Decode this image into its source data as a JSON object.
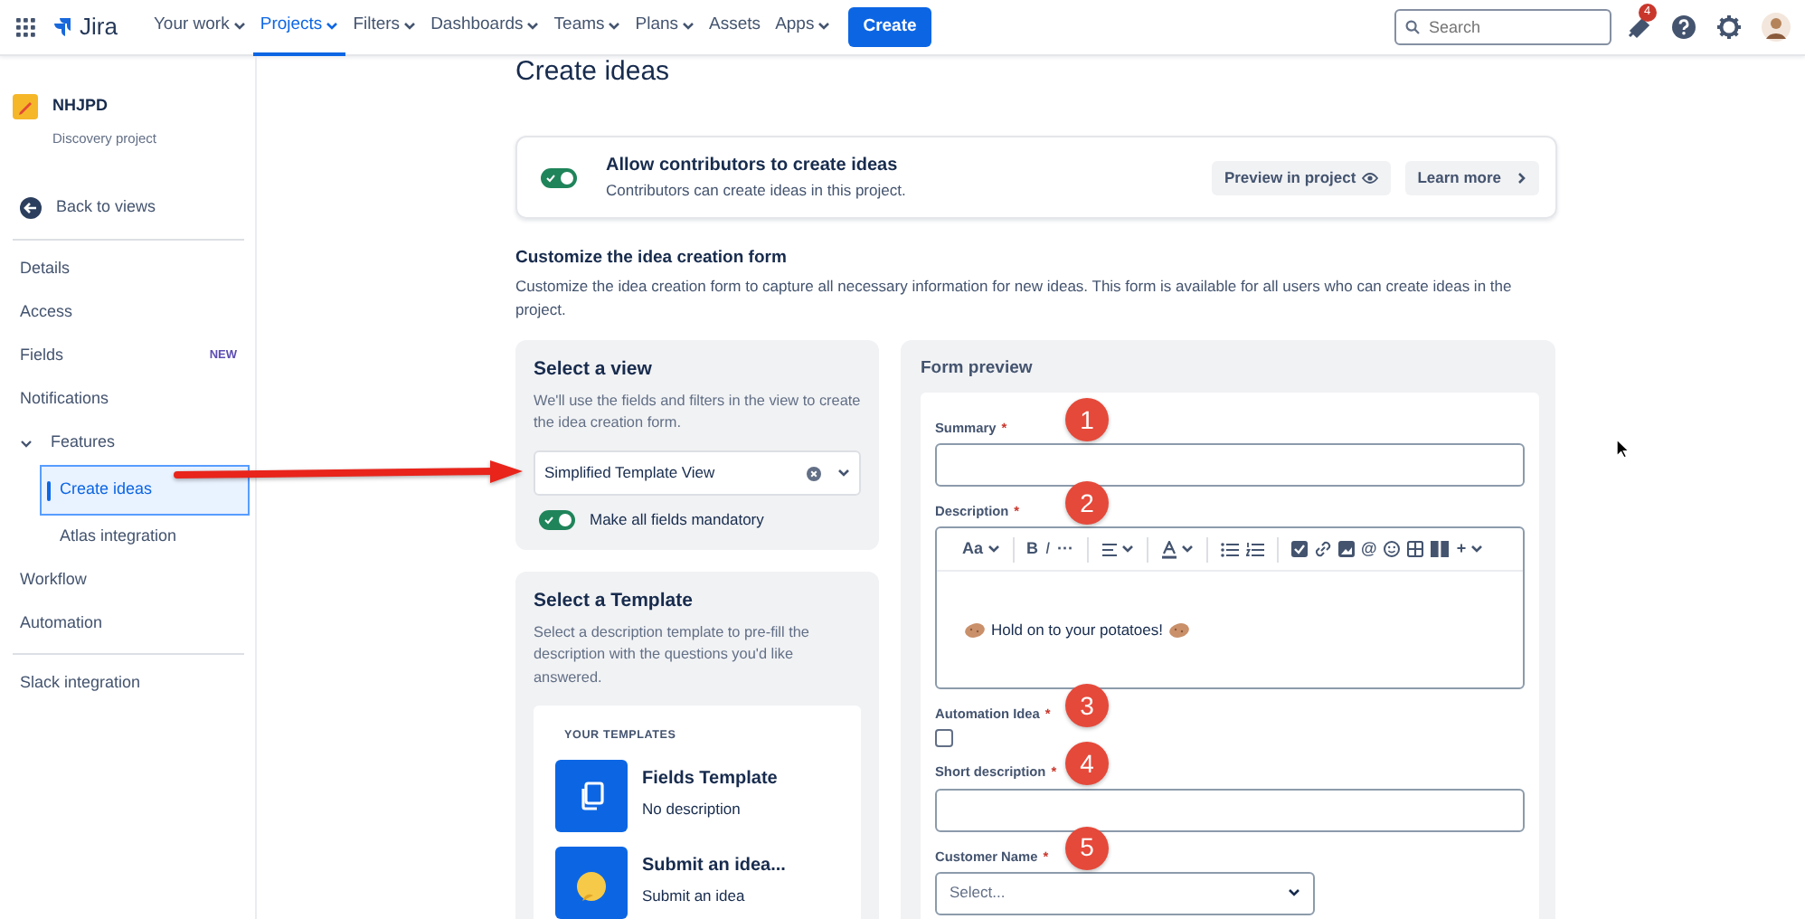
{
  "topnav": {
    "logo": "Jira",
    "items": [
      {
        "label": "Your work",
        "dropdown": true,
        "selected": false
      },
      {
        "label": "Projects",
        "dropdown": true,
        "selected": true
      },
      {
        "label": "Filters",
        "dropdown": true,
        "selected": false
      },
      {
        "label": "Dashboards",
        "dropdown": true,
        "selected": false
      },
      {
        "label": "Teams",
        "dropdown": true,
        "selected": false
      },
      {
        "label": "Plans",
        "dropdown": true,
        "selected": false
      },
      {
        "label": "Assets",
        "dropdown": false,
        "selected": false
      },
      {
        "label": "Apps",
        "dropdown": true,
        "selected": false
      }
    ],
    "create": "Create",
    "search": {
      "placeholder": "Search"
    },
    "notification_count": "4"
  },
  "sidebar": {
    "project": {
      "name": "NHJPD",
      "type": "Discovery project"
    },
    "back": "Back to views",
    "items": [
      {
        "label": "Details",
        "selected": false
      },
      {
        "label": "Access",
        "selected": false
      },
      {
        "label": "Fields",
        "selected": false,
        "badge": "NEW"
      },
      {
        "label": "Notifications",
        "selected": false
      },
      {
        "label": "Features",
        "selected": false,
        "expanded": true,
        "children": [
          {
            "label": "Create ideas",
            "selected": true
          },
          {
            "label": "Atlas integration",
            "selected": false
          }
        ]
      },
      {
        "label": "Workflow",
        "selected": false
      },
      {
        "label": "Automation",
        "selected": false
      }
    ],
    "footer_items": [
      {
        "label": "Slack integration",
        "selected": false
      }
    ]
  },
  "page": {
    "title": "Create ideas",
    "allow": {
      "on": true,
      "title": "Allow contributors to create ideas",
      "subtitle": "Contributors can create ideas in this project.",
      "buttons": [
        {
          "label": "Preview in project",
          "kind": "preview"
        },
        {
          "label": "Learn more",
          "kind": "more"
        }
      ]
    },
    "customize": {
      "heading": "Customize the idea creation form",
      "text": "Customize the idea creation form to capture all necessary information for new ideas. This form is available for all users who can create ideas in the project."
    },
    "view_panel": {
      "heading": "Select a view",
      "text": "We'll use the fields and filters in the view to create the idea creation form.",
      "value": "Simplified Template View",
      "mandatory": {
        "label": "Make all fields mandatory",
        "on": true
      }
    },
    "template_panel": {
      "heading": "Select a Template",
      "text": "Select a description template to pre-fill the description with the questions you'd like answered.",
      "list_heading": "YOUR TEMPLATES",
      "templates": [
        {
          "title": "Fields Template",
          "description": "No description",
          "kind": "document"
        },
        {
          "title": "Submit an idea...",
          "description": "Submit an idea",
          "kind": "emoji"
        }
      ]
    },
    "form_preview": {
      "heading": "Form preview",
      "fields": [
        {
          "label": "Summary",
          "required_mark": "*",
          "kind": "text",
          "marker": "1"
        },
        {
          "label": "Description",
          "required_mark": "*",
          "kind": "rich",
          "marker": "2",
          "toolbar": [
            {
              "kind": "text",
              "label": "Aa",
              "caret": true
            },
            {
              "kind": "separator"
            },
            {
              "kind": "bold",
              "label": "B"
            },
            {
              "kind": "italic",
              "label": "I"
            },
            {
              "kind": "text",
              "label": "···"
            },
            {
              "kind": "separator"
            },
            {
              "kind": "align",
              "caret": true
            },
            {
              "kind": "separator"
            },
            {
              "kind": "text-color",
              "caret": true
            },
            {
              "kind": "separator"
            },
            {
              "kind": "bullet-list"
            },
            {
              "kind": "numbered-list"
            },
            {
              "kind": "separator"
            },
            {
              "kind": "task"
            },
            {
              "kind": "link"
            },
            {
              "kind": "image"
            },
            {
              "kind": "text",
              "label": "@"
            },
            {
              "kind": "emoji"
            },
            {
              "kind": "table"
            },
            {
              "kind": "columns"
            },
            {
              "kind": "text",
              "label": "+",
              "caret": true
            }
          ],
          "content": "Hold on to your potatoes!"
        },
        {
          "label": "Automation Idea",
          "required_mark": "*",
          "kind": "checkbox",
          "checked": false,
          "marker": "3"
        },
        {
          "label": "Short description",
          "required_mark": "*",
          "kind": "text",
          "marker": "4"
        },
        {
          "label": "Customer Name",
          "required_mark": "*",
          "kind": "select",
          "placeholder": "Select...",
          "marker": "5"
        }
      ]
    }
  }
}
